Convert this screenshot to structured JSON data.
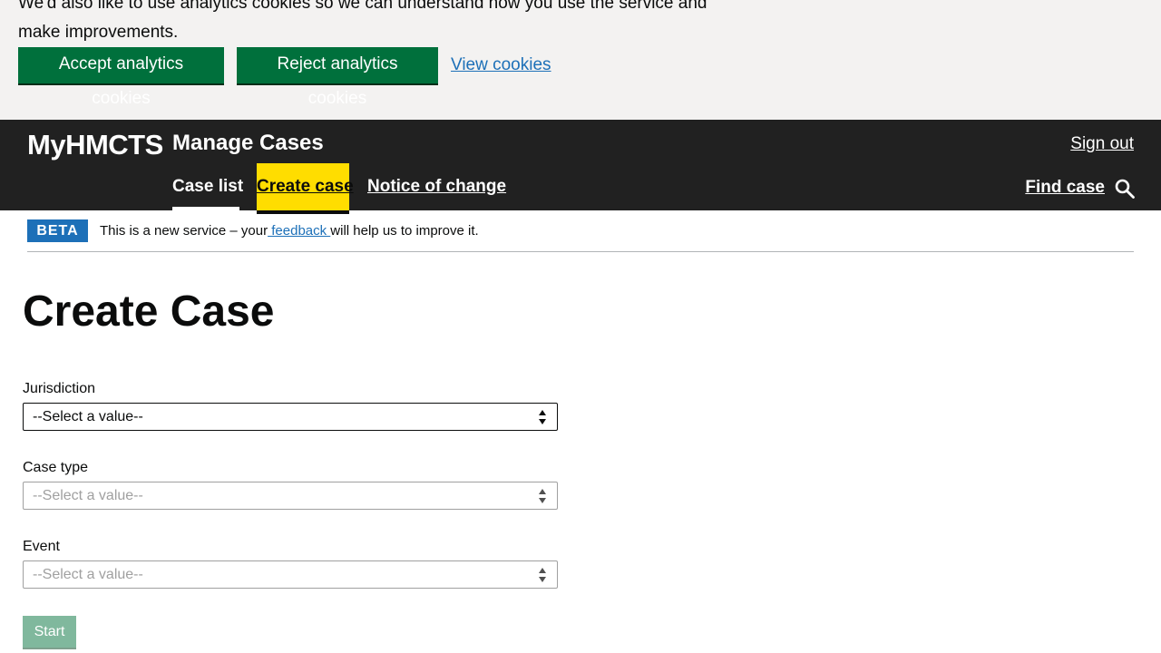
{
  "cookie_banner": {
    "text": "We'd also like to use analytics cookies so we can understand how you use the service and make improvements.",
    "accept_label": "Accept analytics cookies",
    "reject_label": "Reject analytics cookies",
    "view_label": "View cookies"
  },
  "header": {
    "logo": "MyHMCTS",
    "service_name": "Manage Cases",
    "sign_out": "Sign out",
    "nav": {
      "case_list": "Case list",
      "create_case": "Create case",
      "notice_of_change": "Notice of change"
    },
    "find_case": "Find case",
    "search_icon": "search-icon"
  },
  "phase_banner": {
    "tag": "BETA",
    "text_before": "This is a new service – your",
    "link": " feedback ",
    "text_after": " will help us to improve it."
  },
  "main": {
    "title": "Create Case",
    "jurisdiction": {
      "label": "Jurisdiction",
      "value": "--Select a value--"
    },
    "case_type": {
      "label": "Case type",
      "value": "--Select a value--"
    },
    "event": {
      "label": "Event",
      "value": "--Select a value--"
    },
    "start_label": "Start"
  },
  "colors": {
    "brand_green": "#00703c",
    "header_bg": "#212121",
    "nav_active": "#ffdd00",
    "link": "#1d70b8",
    "disabled_button": "#80b89d"
  }
}
